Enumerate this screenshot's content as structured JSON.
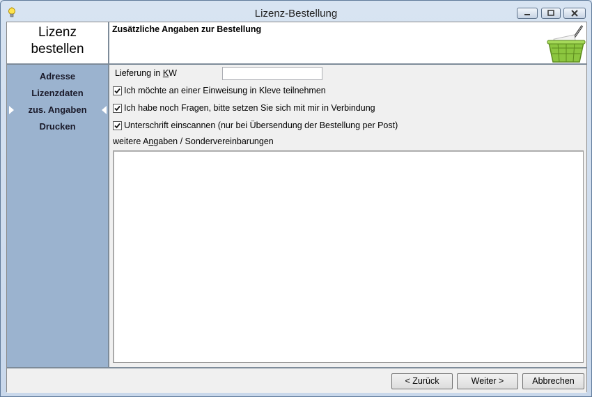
{
  "window": {
    "title": "Lizenz-Bestellung",
    "app_icon": "lightbulb-icon"
  },
  "header": {
    "left_title": "Lizenz bestellen",
    "section_title": "Zusätzliche Angaben zur Bestellung",
    "decor_icon": "shopping-basket-icon"
  },
  "sidebar": {
    "items": [
      {
        "label": "Adresse",
        "active": false
      },
      {
        "label": "Lizenzdaten",
        "active": false
      },
      {
        "label": "zus. Angaben",
        "active": true
      },
      {
        "label": "Drucken",
        "active": false
      }
    ]
  },
  "form": {
    "delivery_label_prefix": "Lieferung in ",
    "delivery_label_key": "K",
    "delivery_label_suffix": "W",
    "delivery_value": "",
    "checkboxes": [
      {
        "label": "Ich möchte an einer Einweisung in Kleve teilnehmen",
        "checked": true
      },
      {
        "label": "Ich habe noch Fragen, bitte setzen Sie sich mit mir in Verbindung",
        "checked": true
      },
      {
        "label": "Unterschrift einscannen (nur bei Übersendung der Bestellung per Post)",
        "checked": true
      }
    ],
    "notes_label_prefix": "weitere A",
    "notes_label_key": "n",
    "notes_label_suffix": "gaben / Sondervereinbarungen",
    "notes_value": ""
  },
  "footer": {
    "back_label": "< Zurück",
    "next_label": "Weiter >",
    "cancel_label": "Abbrechen"
  },
  "colors": {
    "sidebar": "#9bb3cf",
    "separator": "#7d8b99",
    "basket": "#8cc63f"
  }
}
